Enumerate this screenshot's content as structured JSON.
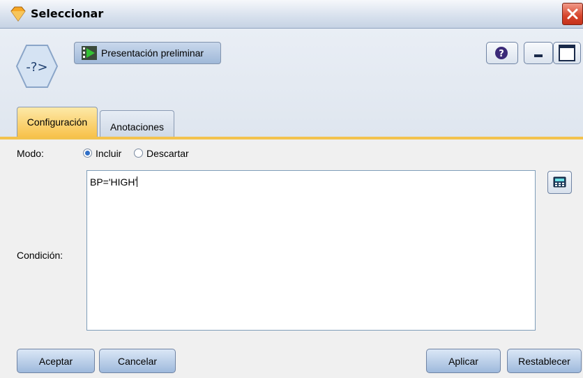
{
  "window": {
    "title": "Seleccionar",
    "icons": {
      "app": "diamond-node-icon",
      "close": "close-icon"
    }
  },
  "toolbar": {
    "node_icon": "select-node-icon",
    "preview_label": "Presentación preliminar",
    "help_icon": "help-icon",
    "minimize_icon": "minimize-icon",
    "maximize_icon": "maximize-icon"
  },
  "tabs": [
    {
      "label": "Configuración",
      "active": true
    },
    {
      "label": "Anotaciones",
      "active": false
    }
  ],
  "mode": {
    "label": "Modo:",
    "options": [
      {
        "label": "Incluir",
        "selected": true
      },
      {
        "label": "Descartar",
        "selected": false
      }
    ]
  },
  "condition": {
    "label": "Condición:",
    "value": "BP='HIGH'",
    "calculator_icon": "expression-builder-icon"
  },
  "buttons": {
    "accept": "Aceptar",
    "cancel": "Cancelar",
    "apply": "Aplicar",
    "reset": "Restablecer"
  },
  "colors": {
    "active_tab": "#f8c24c",
    "tab_underline": "#f3c24d",
    "button_blue": "#9eb9dc"
  }
}
